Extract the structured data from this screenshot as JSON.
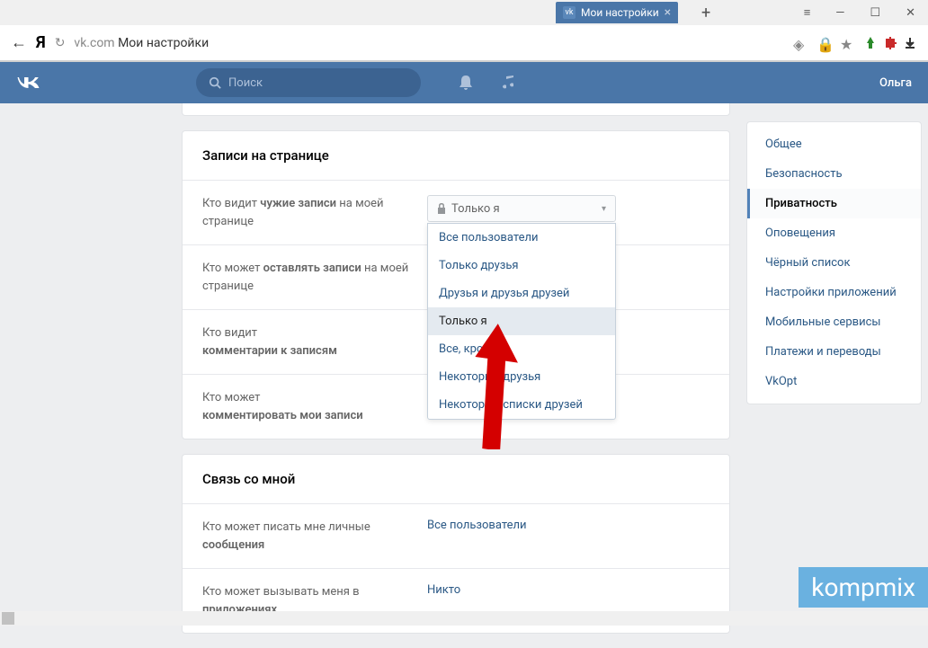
{
  "browser": {
    "tab_title": "Мои настройки",
    "url_domain": "vk.com",
    "url_title": "Мои настройки"
  },
  "vk_header": {
    "search_placeholder": "Поиск",
    "user_name": "Ольга"
  },
  "sections": {
    "posts": {
      "title": "Записи на странице",
      "rows": [
        {
          "label_pre": "Кто видит ",
          "label_b": "чужие записи",
          "label_post": " на моей странице",
          "value": "Только я"
        },
        {
          "label_pre": "Кто может ",
          "label_b": "оставлять записи",
          "label_post": " на моей странице"
        },
        {
          "label_pre": "Кто видит ",
          "label_b": "комментарии к записям",
          "label_post": ""
        },
        {
          "label_pre": "Кто может ",
          "label_b": "комментировать мои записи",
          "label_post": ""
        }
      ]
    },
    "contact": {
      "title": "Связь со мной",
      "rows": [
        {
          "label_pre": "Кто может писать мне личные ",
          "label_b": "сообщения",
          "label_post": "",
          "value": "Все пользователи"
        },
        {
          "label_pre": "Кто может вызывать меня в ",
          "label_b": "приложениях",
          "label_post": "",
          "value": "Никто"
        }
      ]
    }
  },
  "dropdown": {
    "selected": "Только я",
    "options": [
      "Все пользователи",
      "Только друзья",
      "Друзья и друзья друзей",
      "Только я",
      "Все, кроме...",
      "Некоторые друзья",
      "Некоторые списки друзей"
    ],
    "highlighted_index": 3
  },
  "sidebar": {
    "items": [
      "Общее",
      "Безопасность",
      "Приватность",
      "Оповещения",
      "Чёрный список",
      "Настройки приложений",
      "Мобильные сервисы",
      "Платежи и переводы",
      "VkOpt"
    ],
    "active_index": 2
  },
  "watermark": "kompmix"
}
